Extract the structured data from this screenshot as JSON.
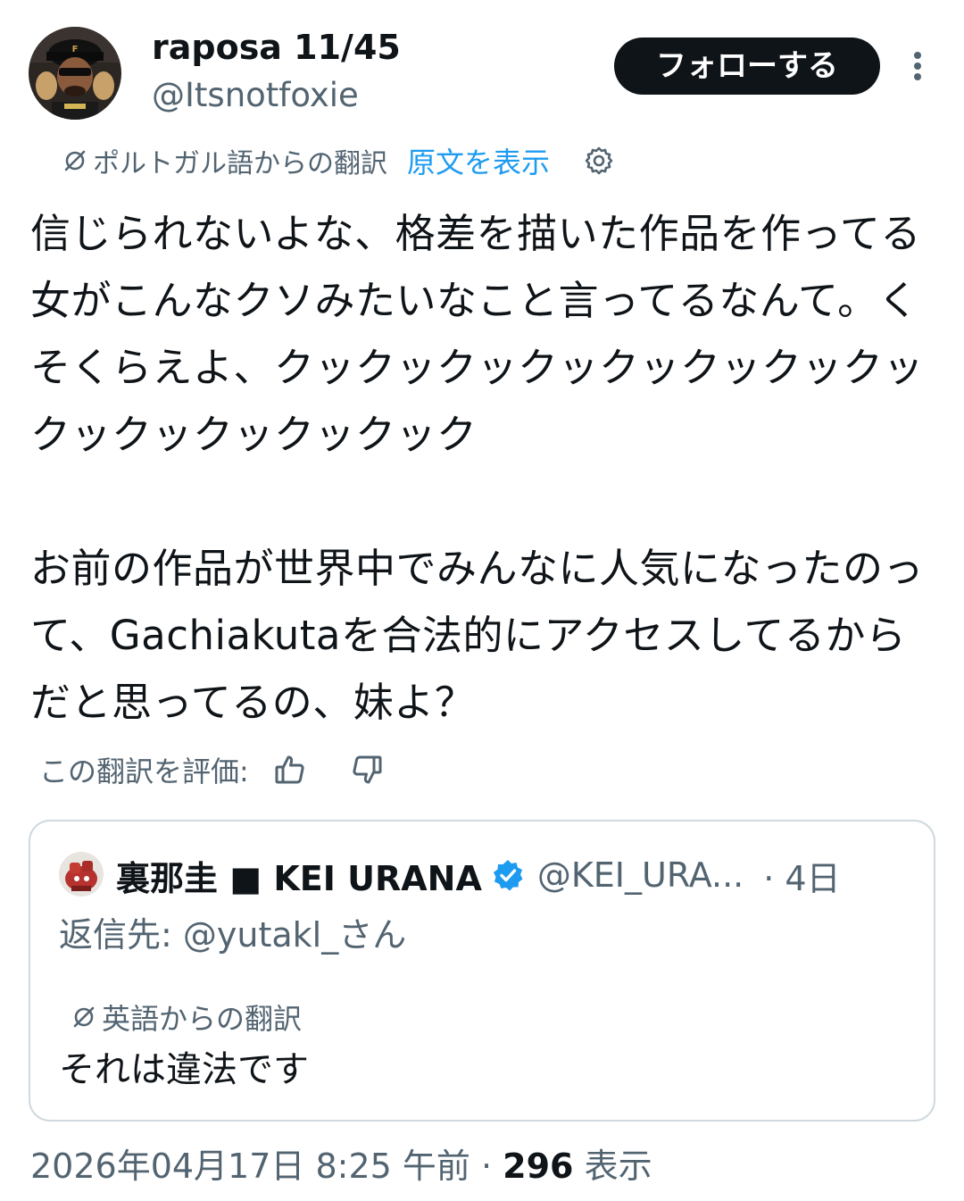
{
  "author": {
    "display_name": "raposa 11/45",
    "handle": "@Itsnotfoxie",
    "avatar_icon": "user-avatar-icon"
  },
  "follow_button": {
    "label": "フォローする"
  },
  "more_icon": "more-vertical-icon",
  "translation": {
    "label": "ポルトガル語からの翻訳",
    "show_original": "原文を表示",
    "settings_icon": "gear-icon"
  },
  "tweet": {
    "paragraphs": [
      "信じられないよな、格差を描いた作品を作ってる女がこんなクソみたいなこと言ってるなんて。くそくらえよ、クックックックックックックックックックックックックック",
      "お前の作品が世界中でみんなに人気になったのって、Gachiakutaを合法的にアクセスしてるからだと思ってるの、妹よ？"
    ]
  },
  "rating": {
    "label": "この翻訳を評価:",
    "thumbs_up_icon": "thumbs-up-icon",
    "thumbs_down_icon": "thumbs-down-icon"
  },
  "quoted_tweet": {
    "display_name": "裏那圭 ■ KEI URANA",
    "verified_icon": "verified-badge-icon",
    "handle": "@KEI_URA...",
    "time": "· 4日",
    "reply_to": "返信先: @yutakl_さん",
    "translation_label": "英語からの翻訳",
    "text": "それは違法です"
  },
  "footer": {
    "timestamp": "2026年04月17日 8:25 午前 · ",
    "views_count": "296",
    "views_label": " 表示"
  },
  "colors": {
    "text_primary": "#0f1419",
    "text_secondary": "#536471",
    "link": "#1d9bf0",
    "verified": "#1d9bf0",
    "border": "#cfd9de"
  }
}
